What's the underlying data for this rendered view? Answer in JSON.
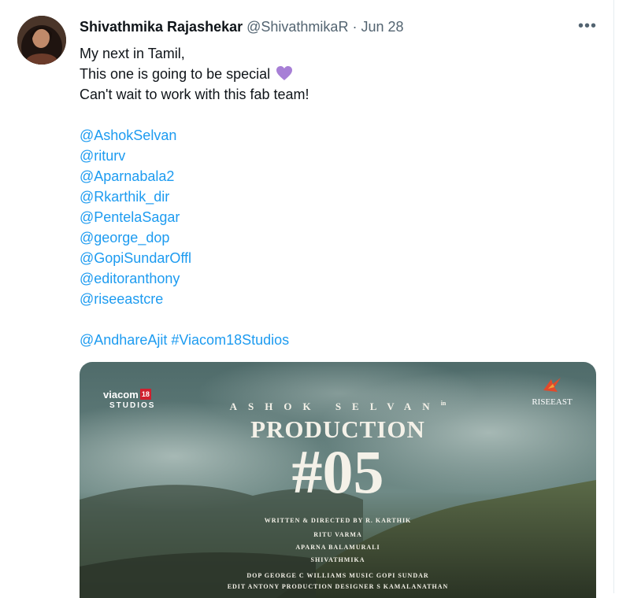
{
  "tweet": {
    "author_name": "Shivathmika Rajashekar",
    "handle": "@ShivathmikaR",
    "separator": "·",
    "date": "Jun 28",
    "more_glyph": "•••",
    "text_lines": [
      "My next in Tamil,",
      "This one is going to be special",
      "Can't wait to work with this fab team!"
    ],
    "mentions": [
      "@AshokSelvan",
      "@riturv",
      "@Aparnabala2",
      "@Rkarthik_dir",
      "@PentelaSagar",
      "@george_dop",
      "@GopiSundarOffl",
      "@editoranthony",
      "@riseeastcre"
    ],
    "last_mention": "@AndhareAjit",
    "hashtag": "#Viacom18Studios"
  },
  "poster": {
    "viacom_logo": "viacom",
    "viacom_badge": "18",
    "viacom_studios": "STUDIOS",
    "rise_logo": "RISEEAST",
    "actor": "ASHOK SELVAN",
    "actor_suffix": "in",
    "production": "PRODUCTION",
    "number": "#05",
    "written_directed": "WRITTEN & DIRECTED BY  R. KARTHIK",
    "cast": [
      "RITU VARMA",
      "APARNA BALAMURALI",
      "SHIVATHMIKA"
    ],
    "crew_line_1": "DOP GEORGE C WILLIAMS  MUSIC GOPI SUNDAR",
    "crew_line_2": "EDIT ANTONY  PRODUCTION DESIGNER S KAMALANATHAN"
  },
  "colors": {
    "link": "#1d9bf0",
    "heart": "#a77fd6",
    "secondary_text": "#536471"
  }
}
